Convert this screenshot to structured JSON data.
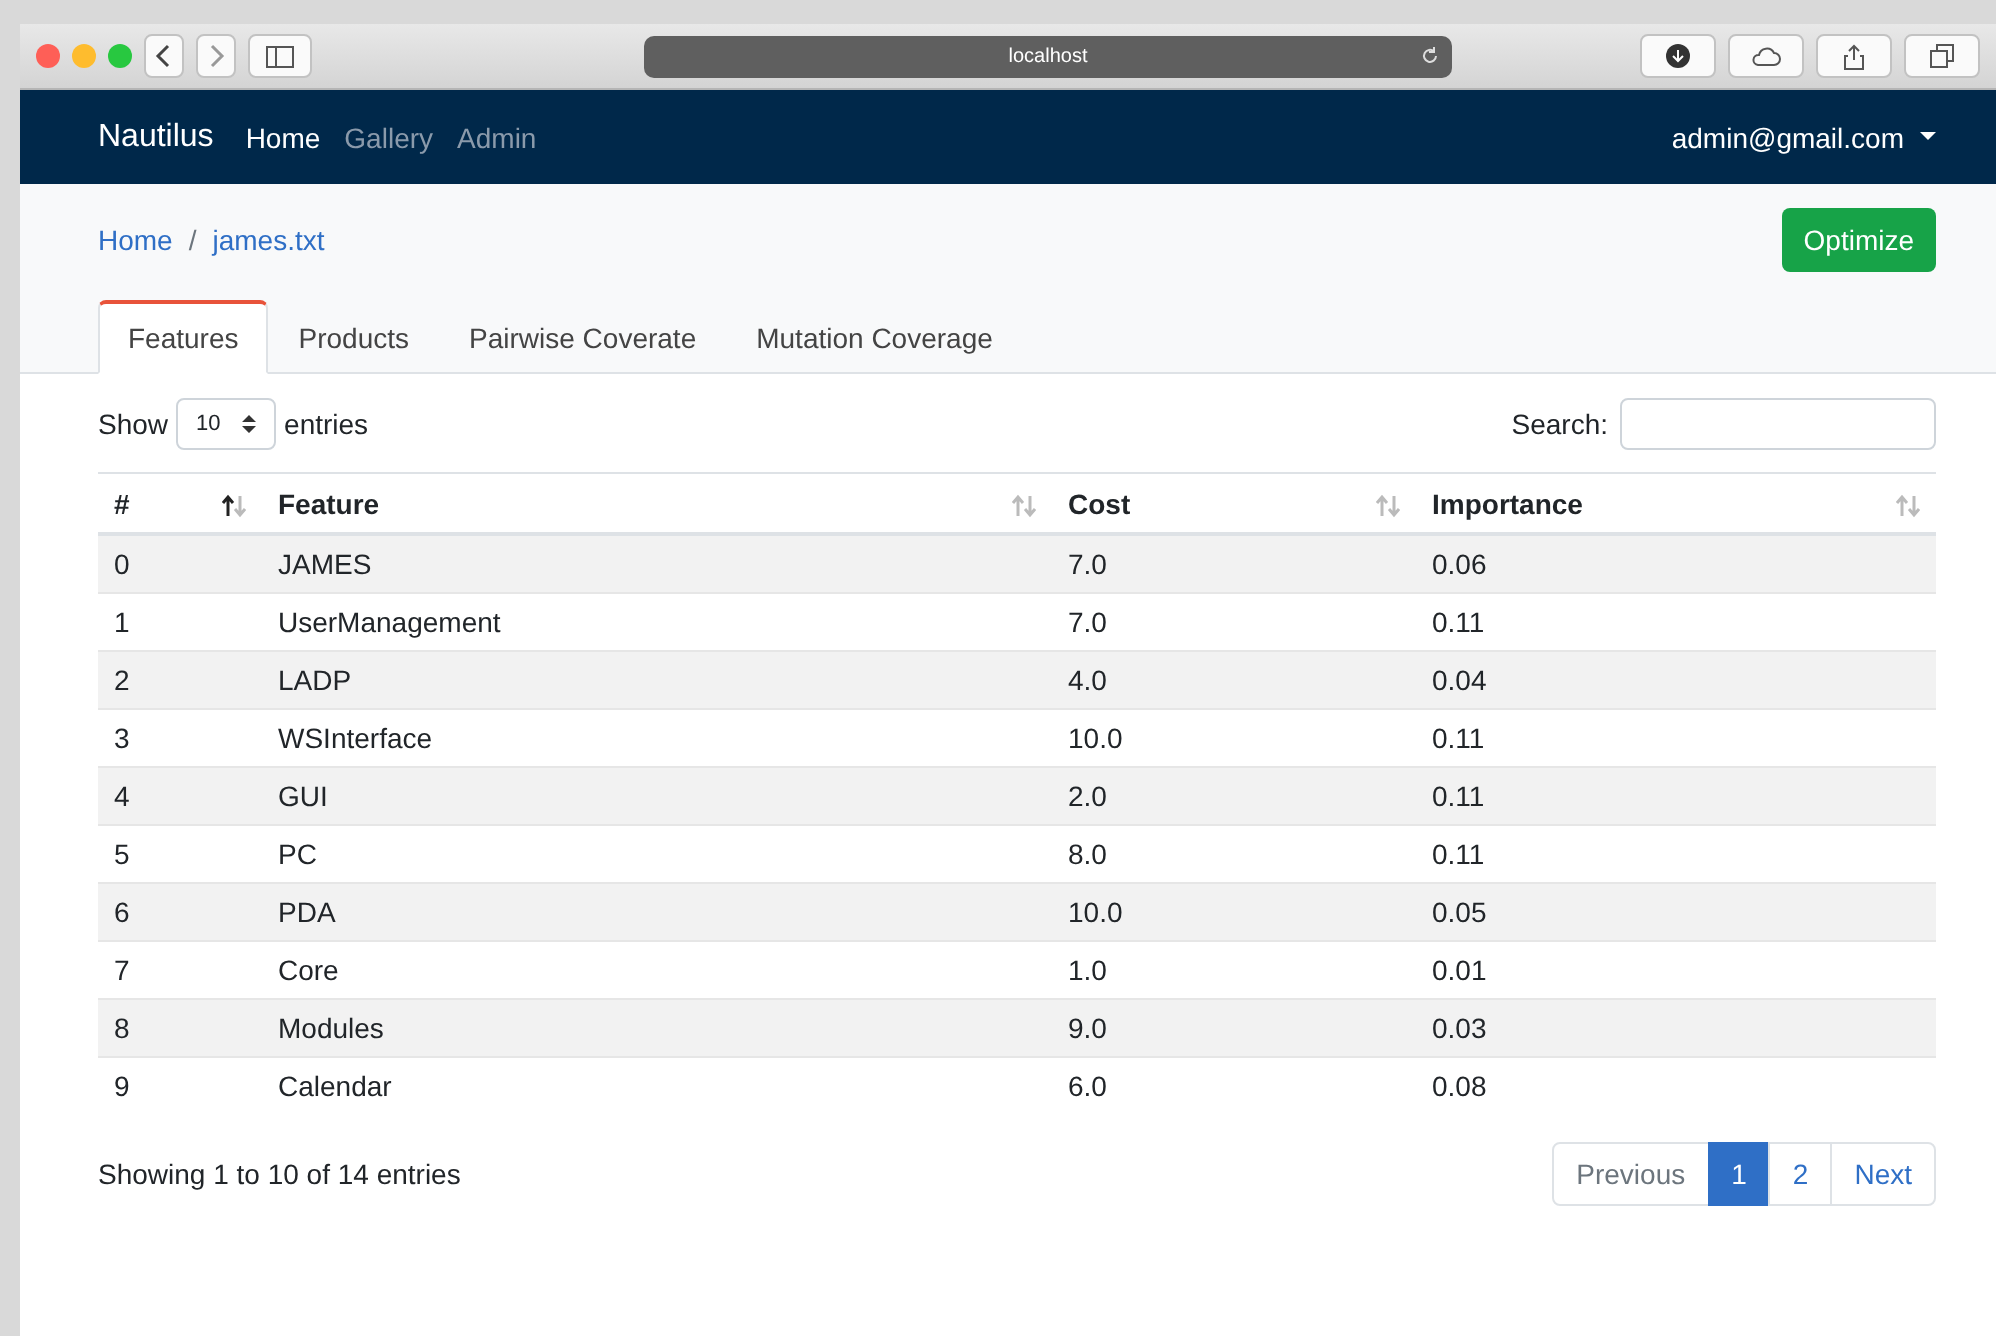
{
  "browser": {
    "address": "localhost"
  },
  "navbar": {
    "brand": "Nautilus",
    "links": [
      {
        "label": "Home",
        "selected": true
      },
      {
        "label": "Gallery",
        "selected": false
      },
      {
        "label": "Admin",
        "selected": false
      }
    ],
    "user": "admin@gmail.com"
  },
  "breadcrumb": {
    "items": [
      "Home",
      "james.txt"
    ],
    "separator": "/"
  },
  "optimize_button": "Optimize",
  "tabs": [
    {
      "label": "Features",
      "selected": true
    },
    {
      "label": "Products",
      "selected": false
    },
    {
      "label": "Pairwise Coverate",
      "selected": false
    },
    {
      "label": "Mutation Coverage",
      "selected": false
    }
  ],
  "length_control": {
    "before": "Show",
    "value": "10",
    "after": "entries"
  },
  "search": {
    "label": "Search:"
  },
  "table": {
    "columns": [
      {
        "label": "#",
        "sorted": true
      },
      {
        "label": "Feature",
        "sorted": false
      },
      {
        "label": "Cost",
        "sorted": false
      },
      {
        "label": "Importance",
        "sorted": false
      }
    ],
    "rows": [
      [
        "0",
        "JAMES",
        "7.0",
        "0.06"
      ],
      [
        "1",
        "UserManagement",
        "7.0",
        "0.11"
      ],
      [
        "2",
        "LADP",
        "4.0",
        "0.04"
      ],
      [
        "3",
        "WSInterface",
        "10.0",
        "0.11"
      ],
      [
        "4",
        "GUI",
        "2.0",
        "0.11"
      ],
      [
        "5",
        "PC",
        "8.0",
        "0.11"
      ],
      [
        "6",
        "PDA",
        "10.0",
        "0.05"
      ],
      [
        "7",
        "Core",
        "1.0",
        "0.01"
      ],
      [
        "8",
        "Modules",
        "9.0",
        "0.03"
      ],
      [
        "9",
        "Calendar",
        "6.0",
        "0.08"
      ]
    ]
  },
  "info": "Showing 1 to 10 of 14 entries",
  "pagination": [
    {
      "label": "Previous",
      "selected": false,
      "disabled": true
    },
    {
      "label": "1",
      "selected": true,
      "disabled": false
    },
    {
      "label": "2",
      "selected": false,
      "disabled": false
    },
    {
      "label": "Next",
      "selected": false,
      "disabled": false
    }
  ]
}
